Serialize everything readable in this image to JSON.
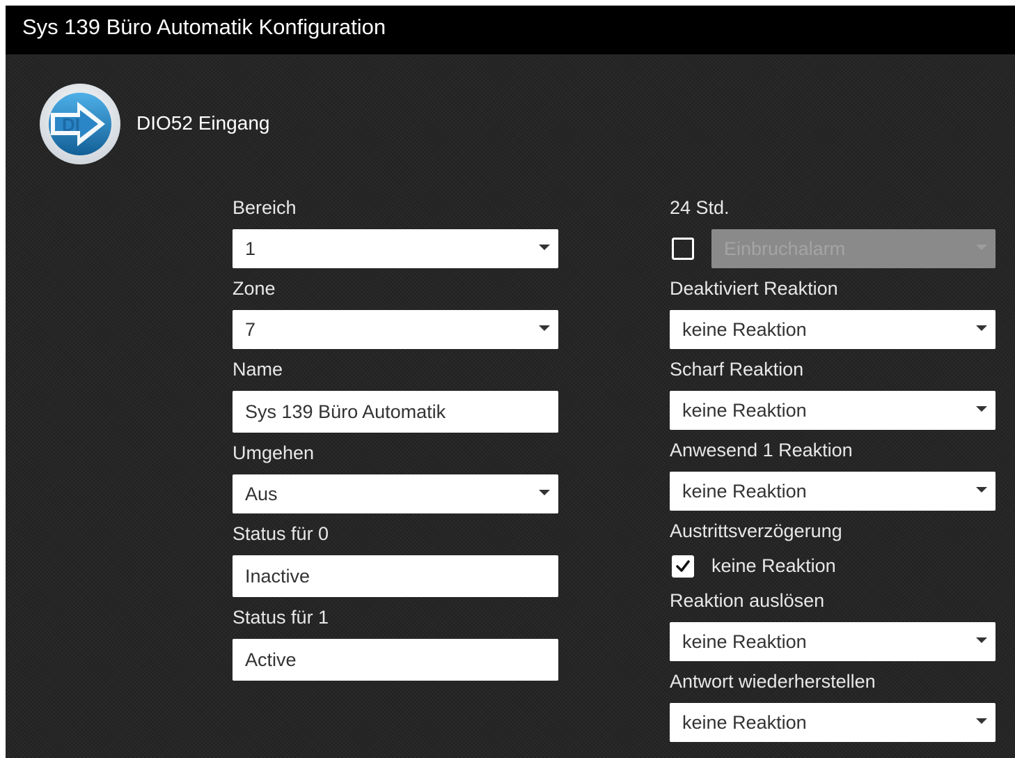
{
  "window": {
    "title": "Sys 139 Büro Automatik Konfiguration"
  },
  "device": {
    "icon": "digital-input-icon",
    "icon_text": "DI",
    "title": "DIO52 Eingang"
  },
  "left": {
    "bereich": {
      "label": "Bereich",
      "value": "1"
    },
    "zone": {
      "label": "Zone",
      "value": "7"
    },
    "name": {
      "label": "Name",
      "value": "Sys 139 Büro Automatik"
    },
    "umgehen": {
      "label": "Umgehen",
      "value": "Aus"
    },
    "status0": {
      "label": "Status für 0",
      "value": "Inactive"
    },
    "status1": {
      "label": "Status für 1",
      "value": "Active"
    }
  },
  "right": {
    "h24": {
      "label": "24 Std.",
      "checked": false,
      "select_value": "Einbruchalarm",
      "select_disabled": true
    },
    "deaktiviert": {
      "label": "Deaktiviert Reaktion",
      "value": "keine Reaktion"
    },
    "scharf": {
      "label": "Scharf Reaktion",
      "value": "keine Reaktion"
    },
    "anwesend1": {
      "label": "Anwesend 1 Reaktion",
      "value": "keine Reaktion"
    },
    "austritt": {
      "label": "Austrittsverzögerung",
      "checked": true,
      "text": "keine Reaktion"
    },
    "ausloesen": {
      "label": "Reaktion auslösen",
      "value": "keine Reaktion"
    },
    "wiederherstellen": {
      "label": "Antwort wiederherstellen",
      "value": "keine Reaktion"
    }
  },
  "colors": {
    "titlebar": "#000000",
    "background": "#262626",
    "icon_blue": "#1a78b8",
    "disabled_field": "#8a8a8a"
  }
}
